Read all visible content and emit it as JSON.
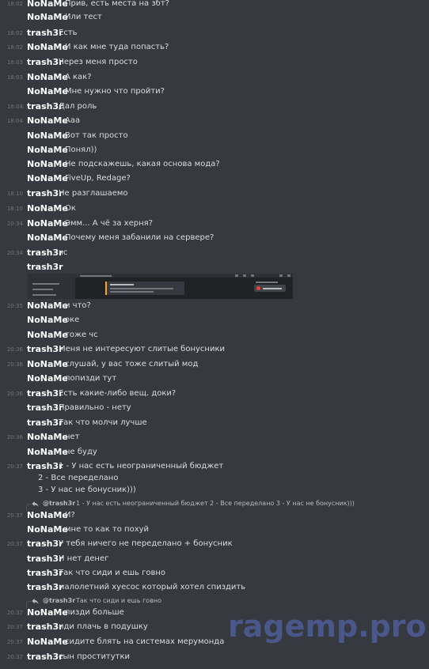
{
  "messages": [
    {
      "time": "18:02",
      "author": "NoNaMe",
      "text": "Прив, есть места на збт?"
    },
    {
      "time": "",
      "author": "NoNaMe",
      "text": "Или тест"
    },
    {
      "time": "18:02",
      "author": "trash3r",
      "text": "Есть"
    },
    {
      "time": "18:02",
      "author": "NoNaMe",
      "text": "И как мне туда попасть?"
    },
    {
      "time": "18:03",
      "author": "trash3r",
      "text": "Через меня просто"
    },
    {
      "time": "18:03",
      "author": "NoNaMe",
      "text": "А как?"
    },
    {
      "time": "",
      "author": "NoNaMe",
      "text": "Мне нужно что пройти?"
    },
    {
      "time": "18:04",
      "author": "trash3r",
      "text": "Дал роль"
    },
    {
      "time": "18:04",
      "author": "NoNaMe",
      "text": "Ааа"
    },
    {
      "time": "",
      "author": "NoNaMe",
      "text": "Вот так просто"
    },
    {
      "time": "",
      "author": "NoNaMe",
      "text": "Понял))"
    },
    {
      "time": "",
      "author": "NoNaMe",
      "text": "Не подскажешь, какая основа мода?"
    },
    {
      "time": "",
      "author": "NoNaMe",
      "text": "FiveUp, Redage?"
    },
    {
      "time": "18:10",
      "author": "trash3r",
      "text": "Не разглашаемо"
    },
    {
      "time": "18:10",
      "author": "NoNaMe",
      "text": "Ок"
    },
    {
      "time": "20:34",
      "author": "NoNaMe",
      "text": "Эмм... А чё за херня?"
    },
    {
      "time": "",
      "author": "NoNaMe",
      "text": "Почему меня забанили на сервере?"
    },
    {
      "time": "20:34",
      "author": "trash3r",
      "text": "чс"
    },
    {
      "time": "",
      "author": "trash3r",
      "text": ""
    },
    {
      "time": "20:35",
      "author": "NoNaMe",
      "text": "и что?"
    },
    {
      "time": "",
      "author": "NoNaMe",
      "text": "оке"
    },
    {
      "time": "",
      "author": "NoNaMe",
      "text": "тоже чс"
    },
    {
      "time": "20:36",
      "author": "trash3r",
      "text": "Меня не интересуют слитые бонусники"
    },
    {
      "time": "20:36",
      "author": "NoNaMe",
      "text": "слушай, у вас тоже слитый мод"
    },
    {
      "time": "",
      "author": "NoNaMe",
      "text": "попизди тут"
    },
    {
      "time": "20:36",
      "author": "trash3r",
      "text": "Есть какие-либо вещ. доки?"
    },
    {
      "time": "",
      "author": "trash3r",
      "text": "Правильно - нету"
    },
    {
      "time": "",
      "author": "trash3r",
      "text": "Так что молчи лучше"
    },
    {
      "time": "20:36",
      "author": "NoNaMe",
      "text": "нет"
    },
    {
      "time": "",
      "author": "NoNaMe",
      "text": "не буду"
    },
    {
      "time": "20:37",
      "author": "trash3r",
      "text": "1 - У нас есть неограниченный бюджет"
    },
    {
      "time": "20:37",
      "author": "NoNaMe",
      "text": "И?"
    },
    {
      "time": "",
      "author": "NoNaMe",
      "text": "мне то как то похуй"
    },
    {
      "time": "20:37",
      "author": "trash3r",
      "text": "У тебя ничего не переделано + бонусник"
    },
    {
      "time": "",
      "author": "trash3r",
      "text": "И нет денег"
    },
    {
      "time": "",
      "author": "trash3r",
      "text": "Так что сиди и ешь говно"
    },
    {
      "time": "",
      "author": "trash3r",
      "text": "малолетний хуесос который хотел спиздить"
    },
    {
      "time": "20:37",
      "author": "NoNaMe",
      "text": "пизди больше"
    },
    {
      "time": "20:37",
      "author": "trash3r",
      "text": "иди плачь в подушку"
    },
    {
      "time": "20:37",
      "author": "NoNaMe",
      "text": "сидите блять на системах мерумонда"
    },
    {
      "time": "20:37",
      "author": "trash3r",
      "text": "сын проститутки"
    }
  ],
  "continuation_lines": [
    "2 - Все переделано",
    "3 - У нас не бонусник)))"
  ],
  "replies": [
    {
      "name": "@trash3r",
      "text": "1 - У нас есть неограниченный бюджет 2 - Все переделано 3 - У нас не бонусник)))"
    },
    {
      "name": "@trash3r",
      "text": "Так что сиди и ешь говно"
    }
  ],
  "attachment": {
    "icon": "screenshot-image",
    "dm_title": "Добро пожаловать",
    "badge": "Ruby RP"
  },
  "watermark": "ragemp.pro",
  "colors": {
    "background": "#36393f",
    "author": "#ffffff",
    "text": "#dcddde",
    "timestamp": "#72767d",
    "watermark": "#4c5a91"
  }
}
